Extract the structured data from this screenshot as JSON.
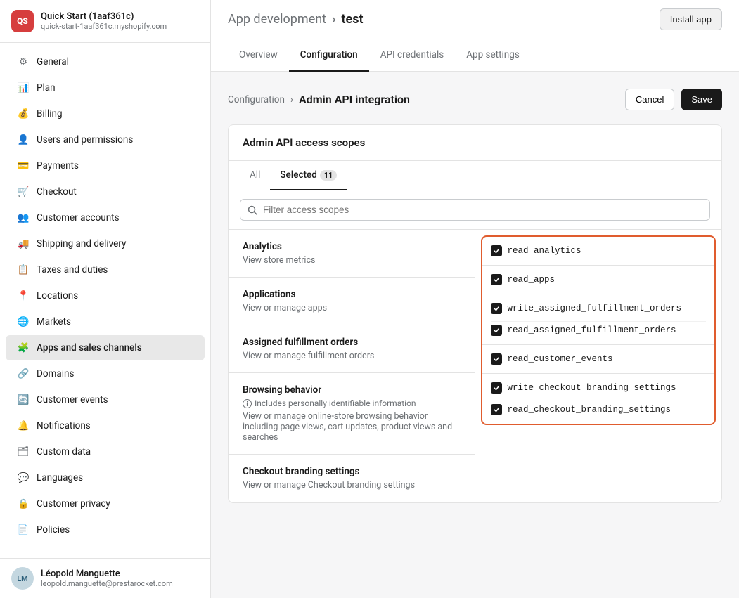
{
  "sidebar": {
    "shop": {
      "name": "Quick Start (1aaf361c)",
      "url": "quick-start-1aaf361c.myshopify.com",
      "logo_text": "QS"
    },
    "items": [
      {
        "id": "general",
        "label": "General",
        "icon": "⚙"
      },
      {
        "id": "plan",
        "label": "Plan",
        "icon": "📊"
      },
      {
        "id": "billing",
        "label": "Billing",
        "icon": "💰"
      },
      {
        "id": "users",
        "label": "Users and permissions",
        "icon": "👤"
      },
      {
        "id": "payments",
        "label": "Payments",
        "icon": "💳"
      },
      {
        "id": "checkout",
        "label": "Checkout",
        "icon": "🛒"
      },
      {
        "id": "customer-accounts",
        "label": "Customer accounts",
        "icon": "👥"
      },
      {
        "id": "shipping",
        "label": "Shipping and delivery",
        "icon": "🚚"
      },
      {
        "id": "taxes",
        "label": "Taxes and duties",
        "icon": "📋"
      },
      {
        "id": "locations",
        "label": "Locations",
        "icon": "📍"
      },
      {
        "id": "markets",
        "label": "Markets",
        "icon": "🌐"
      },
      {
        "id": "apps",
        "label": "Apps and sales channels",
        "icon": "🧩"
      },
      {
        "id": "domains",
        "label": "Domains",
        "icon": "🔗"
      },
      {
        "id": "customer-events",
        "label": "Customer events",
        "icon": "🔄"
      },
      {
        "id": "notifications",
        "label": "Notifications",
        "icon": "🔔"
      },
      {
        "id": "custom-data",
        "label": "Custom data",
        "icon": "🗂"
      },
      {
        "id": "languages",
        "label": "Languages",
        "icon": "💬"
      },
      {
        "id": "customer-privacy",
        "label": "Customer privacy",
        "icon": "🔒"
      },
      {
        "id": "policies",
        "label": "Policies",
        "icon": "📄"
      }
    ],
    "user": {
      "name": "Léopold Manguette",
      "email": "leopold.manguette@prestarocket.com",
      "initials": "LM"
    }
  },
  "header": {
    "breadcrumb_base": "App development",
    "breadcrumb_sep": "›",
    "breadcrumb_current": "test",
    "install_btn": "Install app"
  },
  "tabs": [
    {
      "id": "overview",
      "label": "Overview"
    },
    {
      "id": "configuration",
      "label": "Configuration",
      "active": true
    },
    {
      "id": "api-credentials",
      "label": "API credentials"
    },
    {
      "id": "app-settings",
      "label": "App settings"
    }
  ],
  "page": {
    "breadcrumb_link": "Configuration",
    "breadcrumb_sep": "›",
    "breadcrumb_current": "Admin API integration",
    "cancel_label": "Cancel",
    "save_label": "Save"
  },
  "card": {
    "title": "Admin API access scopes",
    "sub_tabs": [
      {
        "id": "all",
        "label": "All",
        "active": false
      },
      {
        "id": "selected",
        "label": "Selected",
        "active": true,
        "count": "11"
      }
    ],
    "filter_placeholder": "Filter access scopes",
    "scope_sections": [
      {
        "id": "analytics",
        "title": "Analytics",
        "description": "View store metrics",
        "checks": [
          {
            "id": "read_analytics",
            "label": "read_analytics",
            "checked": true
          }
        ]
      },
      {
        "id": "applications",
        "title": "Applications",
        "description": "View or manage apps",
        "checks": [
          {
            "id": "read_apps",
            "label": "read_apps",
            "checked": true
          }
        ]
      },
      {
        "id": "assigned-fulfillment",
        "title": "Assigned fulfillment orders",
        "description": "View or manage fulfillment orders",
        "checks": [
          {
            "id": "write_assigned_fulfillment_orders",
            "label": "write_assigned_fulfillment_orders",
            "checked": true
          },
          {
            "id": "read_assigned_fulfillment_orders",
            "label": "read_assigned_fulfillment_orders",
            "checked": true
          }
        ]
      },
      {
        "id": "browsing-behavior",
        "title": "Browsing behavior",
        "description": "View or manage online-store browsing behavior including page views, cart updates, product views and searches",
        "pii": "Includes personally identifiable information",
        "checks": [
          {
            "id": "read_customer_events",
            "label": "read_customer_events",
            "checked": true
          }
        ]
      },
      {
        "id": "checkout-branding",
        "title": "Checkout branding settings",
        "description": "View or manage Checkout branding settings",
        "checks": [
          {
            "id": "write_checkout_branding_settings",
            "label": "write_checkout_branding_settings",
            "checked": true
          },
          {
            "id": "read_checkout_branding_settings",
            "label": "read_checkout_branding_settings",
            "checked": true
          }
        ]
      }
    ]
  }
}
